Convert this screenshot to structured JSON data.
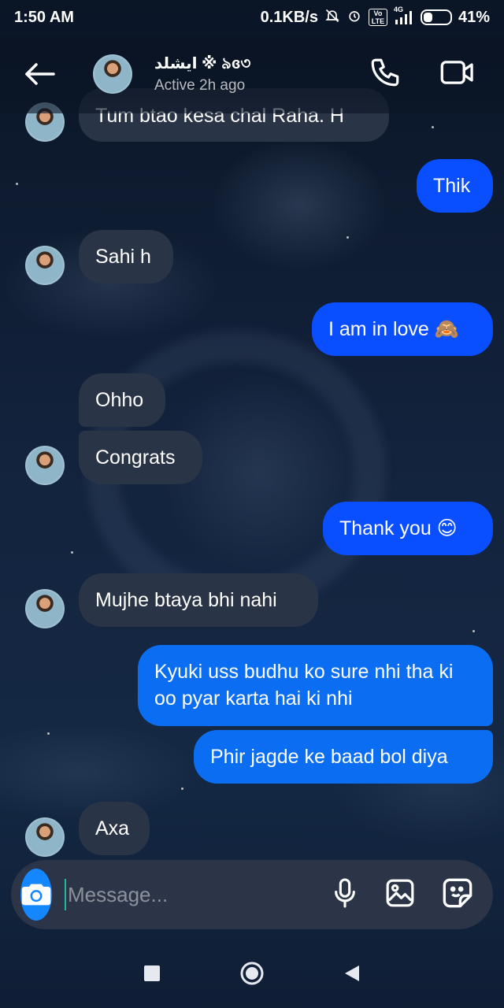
{
  "status_bar": {
    "time": "1:50 AM",
    "net_speed": "0.1KB/s",
    "volte": "Vo LTE",
    "net_type": "4G",
    "battery": "41%",
    "battery_level": 0.41
  },
  "header": {
    "contact_name": "ایشلد ※ ৯ɞ৩",
    "status": "Active 2h ago"
  },
  "messages": [
    {
      "dir": "in",
      "text": "Tum btao kesa chal Raha. H"
    },
    {
      "dir": "out",
      "text": "Thik"
    },
    {
      "dir": "in",
      "text": "Sahi h"
    },
    {
      "dir": "out",
      "text": "I am in love 🙈"
    },
    {
      "dir": "in",
      "text": "Ohho"
    },
    {
      "dir": "in",
      "text": "Congrats"
    },
    {
      "dir": "out",
      "text": "Thank you 😊"
    },
    {
      "dir": "in",
      "text": "Mujhe btaya bhi nahi"
    },
    {
      "dir": "out",
      "text": "Kyuki uss budhu ko sure nhi tha ki oo pyar karta hai ki nhi"
    },
    {
      "dir": "out",
      "text": "Phir jagde ke baad bol diya"
    },
    {
      "dir": "in",
      "text": "Axa"
    }
  ],
  "composer": {
    "placeholder": "Message..."
  },
  "colors": {
    "outgoing_bubble": "#0a4fff",
    "outgoing_bubble_alt": "#0b6ef2",
    "incoming_bubble": "#2a3447",
    "camera_button": "#1487ff"
  }
}
